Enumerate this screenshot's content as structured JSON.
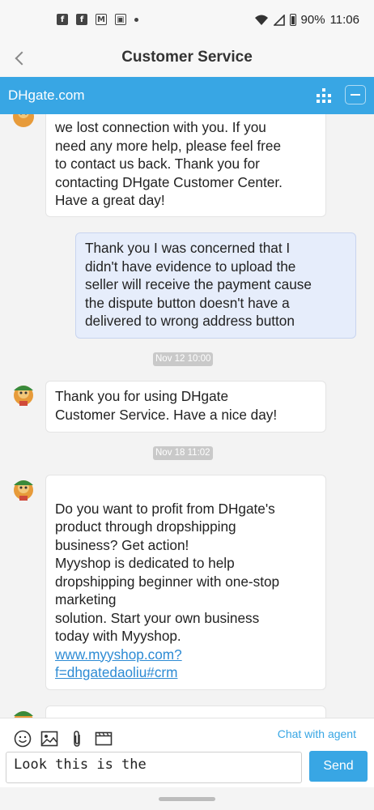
{
  "status_bar": {
    "icons": [
      "facebook-icon",
      "facebook-icon",
      "gmail-icon",
      "photo-icon",
      "dot-icon"
    ],
    "battery": "90%",
    "time": "11:06"
  },
  "header": {
    "title": "Customer Service"
  },
  "brand_bar": {
    "name": "DHgate.com"
  },
  "chat": {
    "messages": [
      {
        "from": "agent",
        "text": "we lost connection with you. If you\nneed any more help, please feel free\nto contact us back. Thank you for\ncontacting DHgate Customer Center.\nHave a great day!"
      },
      {
        "from": "user",
        "text": "Thank you I was concerned that I\ndidn't have evidence to upload the\nseller will receive the payment cause\nthe dispute button doesn't have a\ndelivered to wrong address button"
      },
      {
        "from": "timestamp",
        "text": "Nov 12 10:00"
      },
      {
        "from": "agent",
        "text": "Thank you for using DHgate\nCustomer Service. Have a nice day!"
      },
      {
        "from": "timestamp",
        "text": "Nov 18 11:02"
      },
      {
        "from": "agent",
        "text": "Do you want to profit from DHgate's\nproduct through dropshipping\nbusiness? Get action!\nMyyshop is dedicated to help\ndropshipping beginner with one-stop\nmarketing\nsolution. Start your own business\ntoday with Myyshop.",
        "link": "www.myyshop.com?\nf=dhgatedaoliu#crm"
      }
    ]
  },
  "composer": {
    "tools": [
      "emoji-icon",
      "image-icon",
      "attachment-icon",
      "video-icon"
    ],
    "agent_link": "Chat with agent",
    "input_value": "Look this is the",
    "send_label": "Send"
  }
}
